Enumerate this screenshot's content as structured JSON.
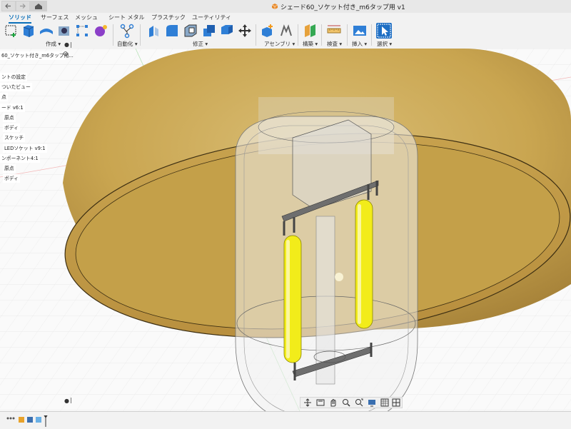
{
  "titlebar": {
    "doc_title": "シェード60_ソケット付き_m6タップ用 v1",
    "doc_icon": "cube-icon",
    "home_icon": "home-icon"
  },
  "ribbon": {
    "tabs": [
      "ソリッド",
      "サーフェス",
      "メッシュ",
      "シート メタル",
      "プラスチック",
      "ユーティリティ"
    ],
    "active_tab": "ソリッド",
    "groups": {
      "create": "作成 ▾",
      "automate": "自動化 ▾",
      "modify": "修正 ▾",
      "assemble": "アセンブリ ▾",
      "construct": "構築 ▾",
      "inspect": "検査 ▾",
      "insert": "挿入 ▾",
      "select": "選択 ▾"
    },
    "accent": "#0b6fb8"
  },
  "browser": {
    "root": "60_ソケット付き_m6タップ用...",
    "items": [
      "ントの設定",
      "ついたビュー",
      "点",
      "ード v6:1",
      "原点",
      "ボディ",
      "スケッチ",
      "LEDソケット v9:1",
      "ンポーネント4:1",
      "原点",
      "ボディ"
    ]
  },
  "navbar": {
    "icons": [
      "orbit-icon",
      "look-at-icon",
      "pan-icon",
      "zoom-icon",
      "fit-icon",
      "display-icon",
      "grid-icon",
      "viewports-icon"
    ]
  },
  "scene": {
    "shade_color": "#c9a550",
    "filament_color": "#f2ec1a"
  }
}
